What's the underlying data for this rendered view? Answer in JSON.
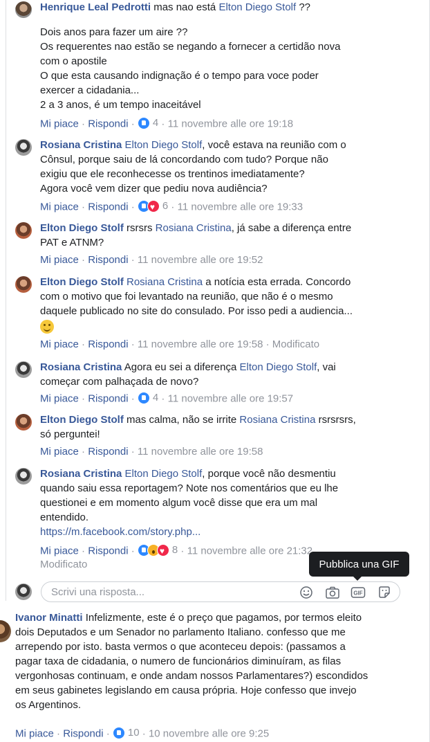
{
  "comments": [
    {
      "author": "Henrique Leal Pedrotti",
      "text_a": "mas nao está",
      "tag1": "Elton Diego Stolf",
      "text_b": "??",
      "lines": [
        "Dois anos para fazer um aire ??",
        "Os requerentes nao estão se negando a fornecer a certidão nova",
        "com o apostile",
        "O que esta causando indignação é o tempo para voce poder",
        "exercer a cidadania...",
        "2 a 3 anos, é um tempo inaceitável"
      ],
      "like": "Mi piace",
      "reply": "Rispondi",
      "reactions": "4",
      "time": "11 novembre alle ore 19:18"
    },
    {
      "author": "Rosiana Cristina",
      "tag1": "Elton Diego Stolf",
      "lines": [
        ", você estava na reunião com o",
        "Cônsul, porque saiu de lá concordando com tudo? Porque não",
        "exigiu que ele reconhecesse os trentinos imediatamente?",
        "Agora você vem dizer que pediu nova audiência?"
      ],
      "like": "Mi piace",
      "reply": "Rispondi",
      "reactions": "6",
      "time": "11 novembre alle ore 19:33"
    },
    {
      "author": "Elton Diego Stolf",
      "text_a": "rsrsrs",
      "tag1": "Rosiana Cristina",
      "text_b": ", já sabe a diferença entre",
      "line2": "PAT e ATNM?",
      "like": "Mi piace",
      "reply": "Rispondi",
      "time": "11 novembre alle ore 19:52"
    },
    {
      "author": "Elton Diego Stolf",
      "tag1": "Rosiana Cristina",
      "text_b": "a notícia esta errada. Concordo",
      "line2": "com o motivo que foi levantado na reunião, que não é o mesmo",
      "line3": "daquele publicado no site do consulado. Por isso pedi a audiencia...",
      "like": "Mi piace",
      "reply": "Rispondi",
      "time": "11 novembre alle ore 19:58",
      "edited": "Modificato"
    },
    {
      "author": "Rosiana Cristina",
      "text_a": "Agora eu sei a diferença",
      "tag1": "Elton Diego Stolf",
      "text_b": ", vai",
      "line2": "começar com palhaçada de novo?",
      "like": "Mi piace",
      "reply": "Rispondi",
      "reactions": "4",
      "time": "11 novembre alle ore 19:57"
    },
    {
      "author": "Elton Diego Stolf",
      "text_a": "mas calma, não se irrite",
      "tag1": "Rosiana Cristina",
      "text_b": "rsrsrsrs,",
      "line2": "só perguntei!",
      "like": "Mi piace",
      "reply": "Rispondi",
      "time": "11 novembre alle ore 19:58"
    },
    {
      "author": "Rosiana Cristina",
      "tag1": "Elton Diego Stolf",
      "text_b": ", porque você não desmentiu",
      "line2": "quando saiu essa reportagem? Note nos comentários que eu lhe",
      "line3": "questionei e em momento algum você disse que era um mal",
      "line4": "entendido.",
      "url": "https://m.facebook.com/story.php...",
      "like": "Mi piace",
      "reply": "Rispondi",
      "reactions": "8",
      "time": "11 novembre alle ore 21:32",
      "edited": "Modificato"
    }
  ],
  "reply_box": {
    "placeholder": "Scrivi una risposta...",
    "tooltip": "Pubblica una GIF",
    "gif_label": "GIF"
  },
  "main_comment": {
    "author": "Ivanor Minatti",
    "lines": [
      "Infelizmente, este é o preço que pagamos, por termos eleito",
      "dois Deputados e um Senador no parlamento Italiano. confesso que me",
      "arrependo por isto. basta vermos o que aconteceu depois: (passamos a",
      "pagar taxa de cidadania, o numero de funcionários diminuíram, as filas",
      "vergonhosas continuam, e onde andam nossos Parlamentares?) escondidos",
      "em seus gabinetes legislando em causa própria. Hoje confesso que invejo",
      "os Argentinos."
    ],
    "like": "Mi piace",
    "reply": "Rispondi",
    "reactions": "10",
    "time": "10 novembre alle ore 9:25"
  },
  "icons": [
    "like-reaction",
    "love-reaction",
    "wow-reaction",
    "emoji-icon",
    "camera-icon",
    "gif-icon",
    "sticker-icon",
    "wink-emoji"
  ],
  "colors": {
    "link": "#385898",
    "meta": "#90949c",
    "like_blue": "#2d88ff",
    "love_red": "#f0284a",
    "tooltip_bg": "#1c1e21"
  }
}
